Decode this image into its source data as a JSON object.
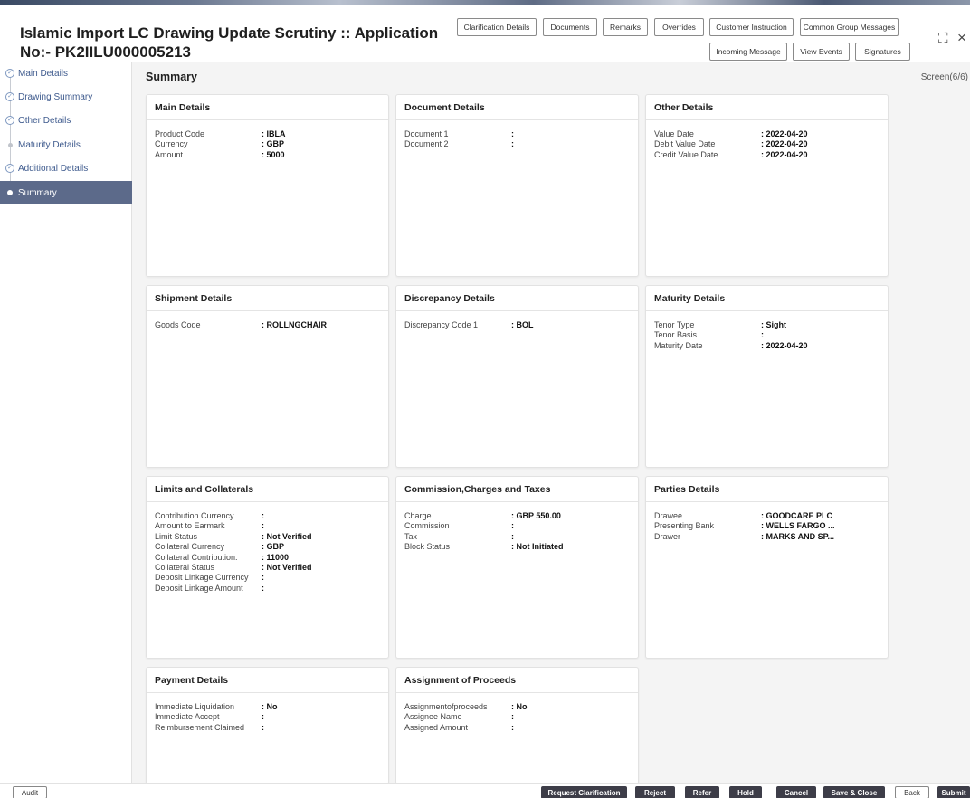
{
  "header": {
    "title_line1": "Islamic Import LC Drawing Update Scrutiny :: Application",
    "title_line2": "No:- PK2IILU000005213",
    "buttons_row1": [
      "Clarification Details",
      "Documents",
      "Remarks",
      "Overrides",
      "Customer Instruction",
      "Common Group Messages"
    ],
    "buttons_row2": [
      "Incoming Message",
      "View Events",
      "Signatures"
    ],
    "maximize_glyph": "⛶",
    "close_glyph": "×"
  },
  "sidebar": {
    "items": [
      {
        "label": "Main Details",
        "state": "done"
      },
      {
        "label": "Drawing Summary",
        "state": "done"
      },
      {
        "label": "Other Details",
        "state": "done"
      },
      {
        "label": "Maturity Details",
        "state": "pending"
      },
      {
        "label": "Additional Details",
        "state": "done"
      },
      {
        "label": "Summary",
        "state": "active"
      }
    ]
  },
  "main": {
    "title": "Summary",
    "screen_label": "Screen(6/6)",
    "cards": [
      {
        "title": "Main Details",
        "rows": [
          [
            "Product Code",
            ": IBLA"
          ],
          [
            "Currency",
            ": GBP"
          ],
          [
            "Amount",
            ": 5000"
          ]
        ]
      },
      {
        "title": "Document Details",
        "rows": [
          [
            "Document 1",
            ":"
          ],
          [
            "Document 2",
            ":"
          ]
        ]
      },
      {
        "title": "Other Details",
        "rows": [
          [
            "Value Date",
            ": 2022-04-20"
          ],
          [
            "Debit Value Date",
            ": 2022-04-20"
          ],
          [
            "Credit Value Date",
            ": 2022-04-20"
          ]
        ]
      },
      {
        "title": "Shipment Details",
        "rows": [
          [
            "Goods Code",
            ": ROLLNGCHAIR"
          ]
        ]
      },
      {
        "title": "Discrepancy Details",
        "rows": [
          [
            "Discrepancy Code 1",
            ": BOL"
          ]
        ]
      },
      {
        "title": "Maturity Details",
        "rows": [
          [
            "Tenor Type",
            ": Sight"
          ],
          [
            "Tenor Basis",
            ":"
          ],
          [
            "Maturity Date",
            ": 2022-04-20"
          ]
        ]
      },
      {
        "title": "Limits and Collaterals",
        "rows": [
          [
            "Contribution Currency",
            ":"
          ],
          [
            "Amount to Earmark",
            ":"
          ],
          [
            "Limit Status",
            ": Not Verified"
          ],
          [
            "Collateral Currency",
            ": GBP"
          ],
          [
            "Collateral Contribution.",
            ": 11000"
          ],
          [
            "Collateral Status",
            ": Not Verified"
          ],
          [
            "Deposit Linkage Currency",
            ":"
          ],
          [
            "Deposit Linkage Amount",
            ":"
          ]
        ]
      },
      {
        "title": "Commission,Charges and Taxes",
        "rows": [
          [
            "Charge",
            ": GBP  550.00"
          ],
          [
            "Commission",
            ":"
          ],
          [
            "Tax",
            ":"
          ],
          [
            "Block Status",
            ": Not Initiated"
          ]
        ]
      },
      {
        "title": "Parties Details",
        "rows": [
          [
            "Drawee",
            ": GOODCARE PLC"
          ],
          [
            "Presenting Bank",
            ": WELLS FARGO ..."
          ],
          [
            "Drawer",
            ": MARKS AND SP..."
          ]
        ]
      },
      {
        "title": "Payment Details",
        "rows": [
          [
            "Immediate Liquidation",
            ": No"
          ],
          [
            "Immediate Accept",
            ":"
          ],
          [
            "Reimbursement Claimed",
            ":"
          ]
        ]
      },
      {
        "title": "Assignment of Proceeds",
        "rows": [
          [
            "Assignmentofproceeds",
            ": No"
          ],
          [
            "Assignee Name",
            ":"
          ],
          [
            "Assigned Amount",
            ":"
          ]
        ]
      }
    ]
  },
  "footer": {
    "audit": "Audit",
    "buttons": [
      "Request Clarification",
      "Reject",
      "Refer",
      "Hold",
      "Cancel",
      "Save & Close",
      "Back",
      "Submit"
    ]
  }
}
